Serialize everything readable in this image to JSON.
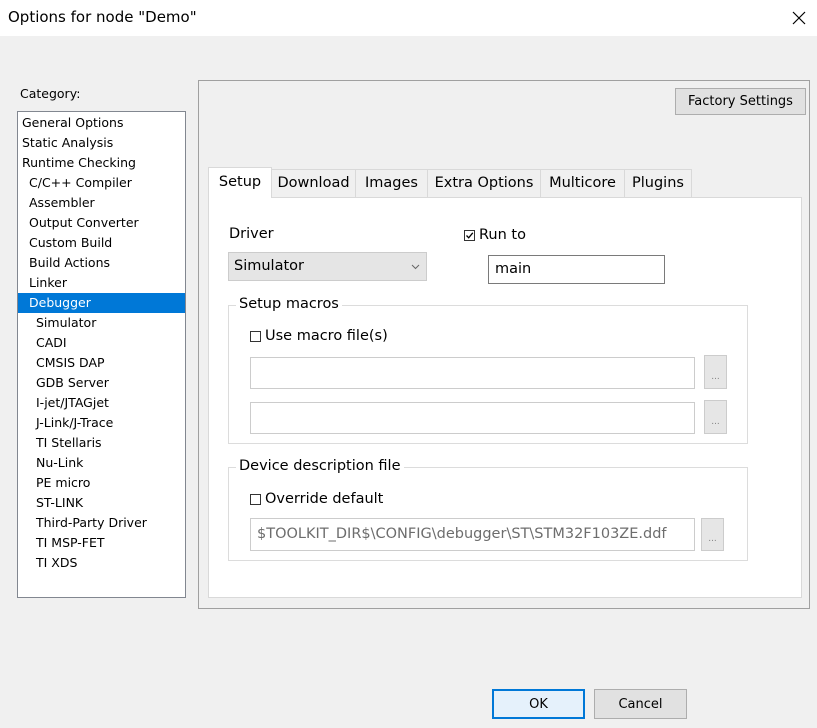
{
  "window": {
    "title": "Options for node \"Demo\""
  },
  "category": {
    "label": "Category:",
    "items": [
      {
        "label": "General Options",
        "level": 0
      },
      {
        "label": "Static Analysis",
        "level": 0
      },
      {
        "label": "Runtime Checking",
        "level": 0
      },
      {
        "label": "C/C++ Compiler",
        "level": 1
      },
      {
        "label": "Assembler",
        "level": 1
      },
      {
        "label": "Output Converter",
        "level": 1
      },
      {
        "label": "Custom Build",
        "level": 1
      },
      {
        "label": "Build Actions",
        "level": 1
      },
      {
        "label": "Linker",
        "level": 1
      },
      {
        "label": "Debugger",
        "level": 1,
        "selected": true
      },
      {
        "label": "Simulator",
        "level": 2
      },
      {
        "label": "CADI",
        "level": 2
      },
      {
        "label": "CMSIS DAP",
        "level": 2
      },
      {
        "label": "GDB Server",
        "level": 2
      },
      {
        "label": "I-jet/JTAGjet",
        "level": 2
      },
      {
        "label": "J-Link/J-Trace",
        "level": 2
      },
      {
        "label": "TI Stellaris",
        "level": 2
      },
      {
        "label": "Nu-Link",
        "level": 2
      },
      {
        "label": "PE micro",
        "level": 2
      },
      {
        "label": "ST-LINK",
        "level": 2
      },
      {
        "label": "Third-Party Driver",
        "level": 2
      },
      {
        "label": "TI MSP-FET",
        "level": 2
      },
      {
        "label": "TI XDS",
        "level": 2
      }
    ]
  },
  "factory_settings_label": "Factory Settings",
  "tabs": [
    {
      "label": "Setup",
      "active": true
    },
    {
      "label": "Download"
    },
    {
      "label": "Images"
    },
    {
      "label": "Extra Options"
    },
    {
      "label": "Multicore"
    },
    {
      "label": "Plugins"
    }
  ],
  "setup": {
    "driver_label": "Driver",
    "driver_value": "Simulator",
    "run_to_label": "Run to",
    "run_to_checked": true,
    "run_to_value": "main",
    "setup_macros_title": "Setup macros",
    "use_macro_label": "Use macro file(s)",
    "use_macro_checked": false,
    "macro_file_1": "",
    "macro_file_2": "",
    "browse_label": "...",
    "device_desc_title": "Device description file",
    "override_label": "Override default",
    "override_checked": false,
    "device_file": "$TOOLKIT_DIR$\\CONFIG\\debugger\\ST\\STM32F103ZE.ddf"
  },
  "buttons": {
    "ok": "OK",
    "cancel": "Cancel"
  },
  "colors": {
    "selection": "#0078d7",
    "dialog_bg": "#f0f0f0"
  }
}
